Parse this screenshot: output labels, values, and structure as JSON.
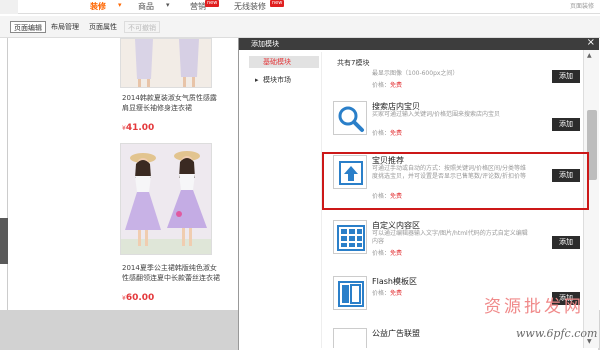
{
  "topnav": {
    "items": [
      "装修",
      "商品",
      "营销",
      "无线装修"
    ],
    "badges": [
      "new",
      "new"
    ],
    "right_text": "页面装修"
  },
  "toolbar": {
    "buttons": [
      "页面编辑",
      "布局管理",
      "页面属性",
      "不可撤销"
    ]
  },
  "products": [
    {
      "name": "2014韩款夏装淑女气质性感露肩显瘦长袖修身连衣裙",
      "price": "41.00",
      "currency": "¥"
    },
    {
      "name": "2014夏季公主裙韩版纯色淑女性感翻领连夏中长款蕾丝连衣裙",
      "price": "60.00",
      "currency": "¥"
    }
  ],
  "dialog": {
    "title": "添加模块",
    "close": "×",
    "tabs": [
      "基础模块",
      "模块市场"
    ],
    "count_text": "共有7模块",
    "modules": [
      {
        "name": "",
        "desc": "最显示图像（100-600px之间）",
        "price_label": "价格：",
        "price": "免费",
        "add_label": "添加"
      },
      {
        "name": "搜索店内宝贝",
        "desc": "买家可通过输入关键词/价格范围来搜索店内宝贝",
        "price_label": "价格：",
        "price": "免费",
        "add_label": "添加"
      },
      {
        "name": "宝贝推荐",
        "desc": "可通过手动或自动的方式：按照关键词/价格区间/分类等维度挑选宝贝，并可设置是否显示已售笔数/评论数/折扣价等",
        "price_label": "价格：",
        "price": "免费",
        "add_label": "添加"
      },
      {
        "name": "自定义内容区",
        "desc": "可以通过编辑器输入文字/图片/html代码的方式自定义编辑内容",
        "price_label": "价格：",
        "price": "免费",
        "add_label": "添加"
      },
      {
        "name": "Flash模板区",
        "desc": "",
        "price_label": "价格：",
        "price": "免费",
        "add_label": "添加"
      },
      {
        "name": "公益广告联盟",
        "desc": "",
        "price_label": "",
        "price": "",
        "add_label": ""
      }
    ]
  },
  "watermark": {
    "text": "资源批发网",
    "url": "www.6pfc.com"
  },
  "colors": {
    "accent": "#ff6600",
    "price": "#e4393c",
    "highlight": "#cc1818",
    "dialog_header": "#3d3d3d",
    "add_button": "#2c2c2c"
  }
}
